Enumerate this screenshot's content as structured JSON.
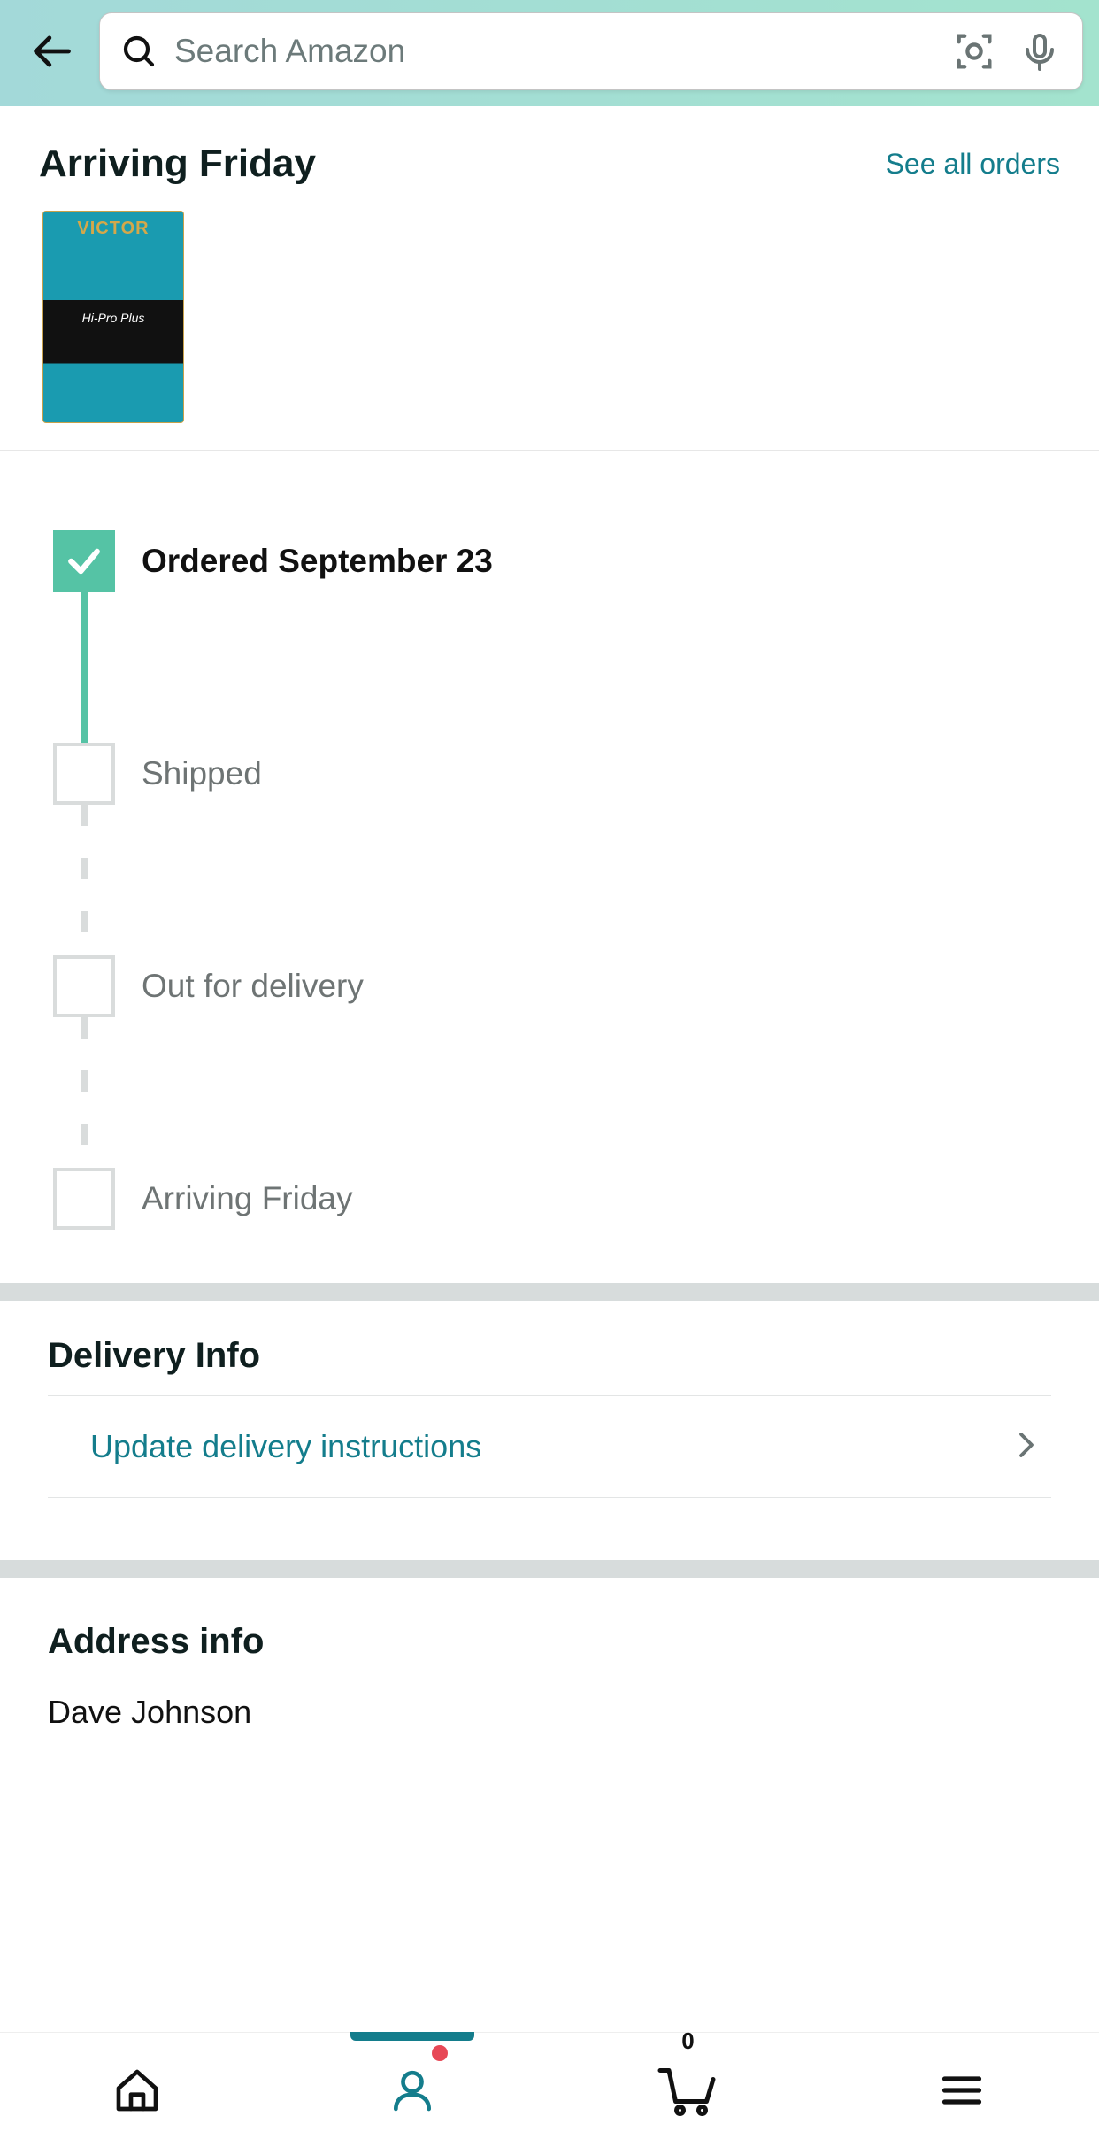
{
  "search": {
    "placeholder": "Search Amazon"
  },
  "orderHeader": {
    "title": "Arriving Friday",
    "seeAll": "See all orders"
  },
  "product": {
    "brand": "VICTOR",
    "label": "Hi-Pro Plus"
  },
  "tracker": {
    "steps": [
      {
        "label": "Ordered September 23",
        "done": true
      },
      {
        "label": "Shipped",
        "done": false
      },
      {
        "label": "Out for delivery",
        "done": false
      },
      {
        "label": "Arriving Friday",
        "done": false
      }
    ]
  },
  "deliveryInfo": {
    "title": "Delivery Info",
    "updateInstructions": "Update delivery instructions"
  },
  "addressInfo": {
    "title": "Address info",
    "name": "Dave Johnson"
  },
  "bottomNav": {
    "cartCount": "0"
  }
}
